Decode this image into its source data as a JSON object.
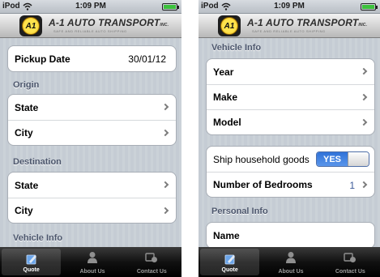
{
  "status_bar": {
    "carrier": "iPod",
    "time": "1:09 PM"
  },
  "header": {
    "brand": "A-1 AUTO TRANSPORT",
    "brand_suffix": "INC.",
    "tagline": "SAFE AND RELIABLE AUTO SHIPPING",
    "logo_text": "A1"
  },
  "left_screen": {
    "pickup": {
      "label": "Pickup Date",
      "value": "30/01/12"
    },
    "origin": {
      "section": "Origin",
      "rows": [
        "State",
        "City"
      ]
    },
    "destination": {
      "section": "Destination",
      "rows": [
        "State",
        "City"
      ]
    },
    "vehicle_section": "Vehicle Info"
  },
  "right_screen": {
    "vehicle": {
      "section": "Vehicle Info",
      "rows": [
        "Year",
        "Make",
        "Model"
      ]
    },
    "household": {
      "ship_label": "Ship household goods",
      "toggle": "YES",
      "bedrooms_label": "Number of Bedrooms",
      "bedrooms_value": "1"
    },
    "personal": {
      "section": "Personal Info",
      "name_label": "Name"
    }
  },
  "tabs": [
    {
      "label": "Quote",
      "icon": "quote-icon",
      "active": true
    },
    {
      "label": "About Us",
      "icon": "person-icon",
      "active": false
    },
    {
      "label": "Contact Us",
      "icon": "contact-icon",
      "active": false
    }
  ],
  "colors": {
    "accent": "#3b74d8",
    "section_text": "#4c566c",
    "value_blue": "#3b5998"
  }
}
